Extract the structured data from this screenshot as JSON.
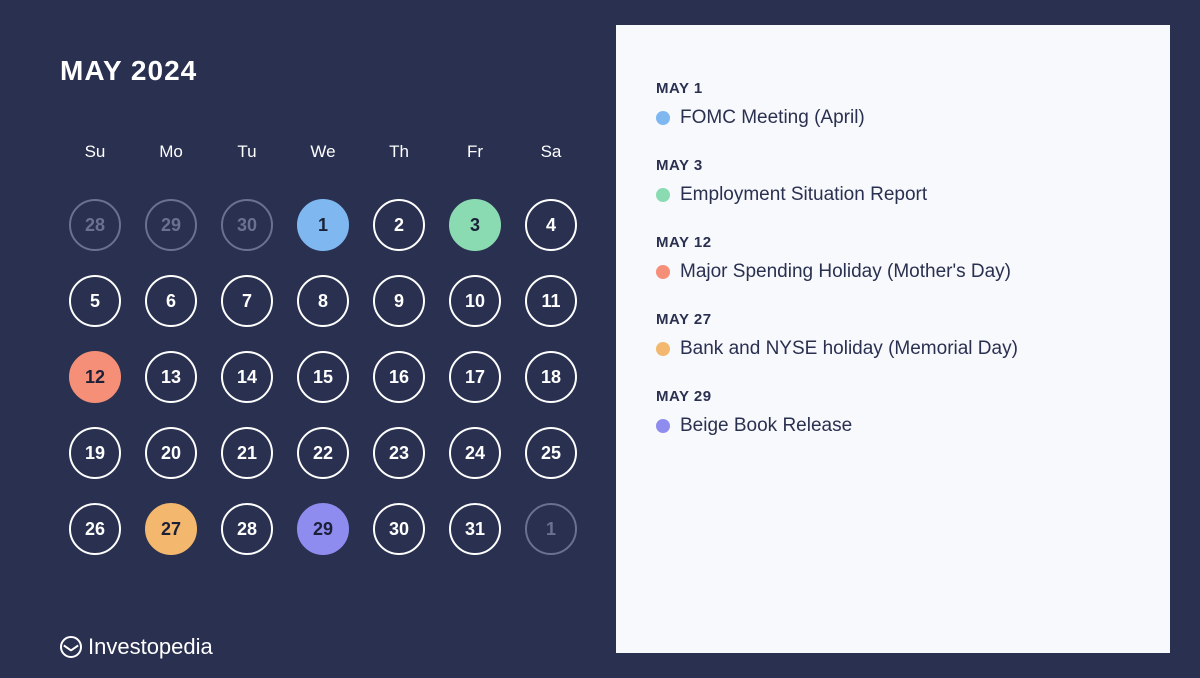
{
  "title": "MAY 2024",
  "weekdays": [
    "Su",
    "Mo",
    "Tu",
    "We",
    "Th",
    "Fr",
    "Sa"
  ],
  "brand": "Investopedia",
  "days": [
    {
      "n": "28",
      "muted": true
    },
    {
      "n": "29",
      "muted": true
    },
    {
      "n": "30",
      "muted": true
    },
    {
      "n": "1",
      "hl": "blue"
    },
    {
      "n": "2"
    },
    {
      "n": "3",
      "hl": "green"
    },
    {
      "n": "4"
    },
    {
      "n": "5"
    },
    {
      "n": "6"
    },
    {
      "n": "7"
    },
    {
      "n": "8"
    },
    {
      "n": "9"
    },
    {
      "n": "10"
    },
    {
      "n": "11"
    },
    {
      "n": "12",
      "hl": "red"
    },
    {
      "n": "13"
    },
    {
      "n": "14"
    },
    {
      "n": "15"
    },
    {
      "n": "16"
    },
    {
      "n": "17"
    },
    {
      "n": "18"
    },
    {
      "n": "19"
    },
    {
      "n": "20"
    },
    {
      "n": "21"
    },
    {
      "n": "22"
    },
    {
      "n": "23"
    },
    {
      "n": "24"
    },
    {
      "n": "25"
    },
    {
      "n": "26"
    },
    {
      "n": "27",
      "hl": "orange"
    },
    {
      "n": "28"
    },
    {
      "n": "29",
      "hl": "purple"
    },
    {
      "n": "30"
    },
    {
      "n": "31"
    },
    {
      "n": "1",
      "muted": true
    }
  ],
  "events": [
    {
      "date": "MAY 1",
      "color": "blue",
      "label": "FOMC Meeting (April)"
    },
    {
      "date": "MAY 3",
      "color": "green",
      "label": "Employment Situation Report"
    },
    {
      "date": "MAY 12",
      "color": "red",
      "label": "Major Spending Holiday (Mother's Day)"
    },
    {
      "date": "MAY 27",
      "color": "orange",
      "label": "Bank and NYSE holiday (Memorial Day)"
    },
    {
      "date": "MAY 29",
      "color": "purple",
      "label": "Beige Book Release"
    }
  ]
}
